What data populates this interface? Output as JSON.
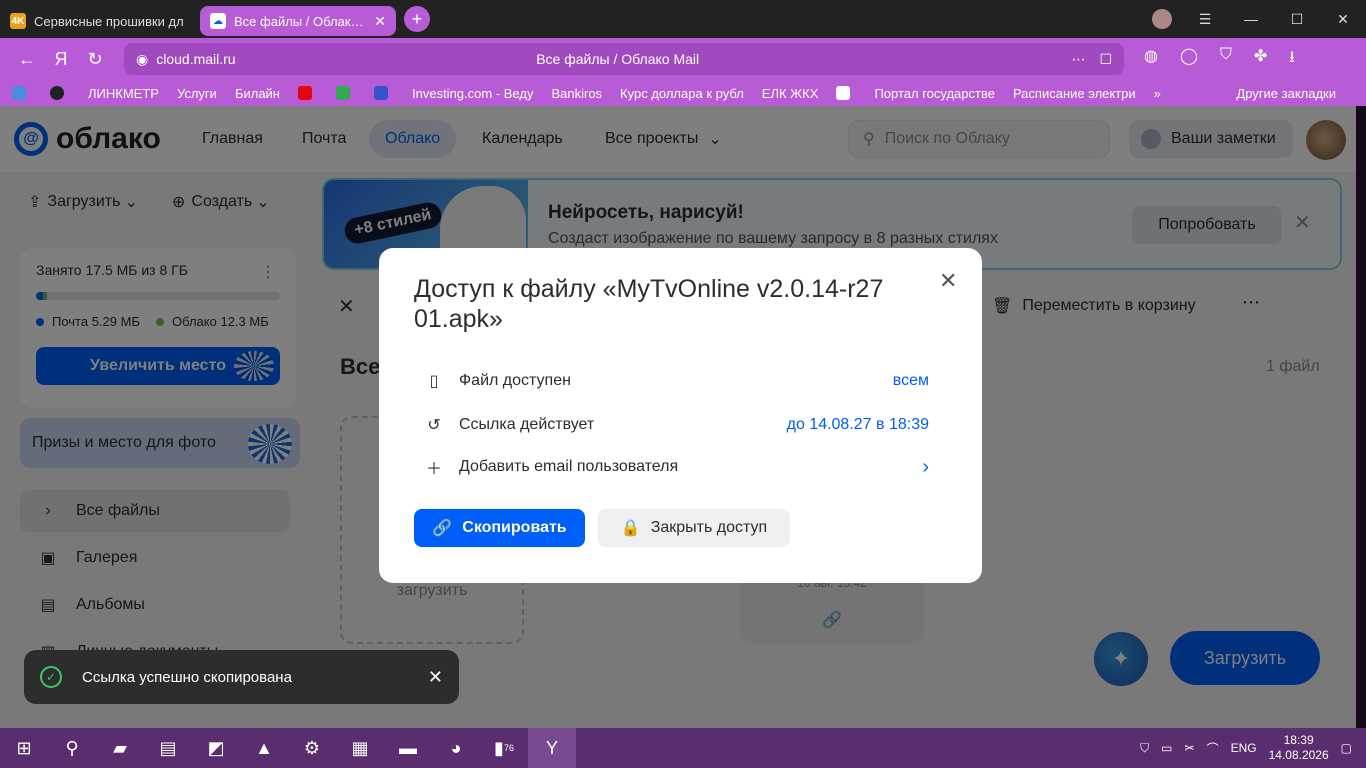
{
  "browser": {
    "tabs": [
      {
        "label": "Сервисные прошивки дл",
        "icon": "4k-icon"
      },
      {
        "label": "Все файлы / Облако Mail",
        "icon": "cloud-icon",
        "active": true
      }
    ],
    "url": "cloud.mail.ru",
    "page_title": "Все файлы / Облако Mail",
    "bookmarks": [
      "ЛИНКМЕТР",
      "Услуги",
      "Билайн",
      "Investing.com - Веду",
      "Bankiros",
      "Курс доллара к рубл",
      "ЕЛК ЖКХ",
      "Портал государстве",
      "Расписание электри"
    ],
    "bookmarks_more": "»",
    "bookmarks_other": "Другие закладки"
  },
  "header": {
    "logo": "облако",
    "nav": [
      "Главная",
      "Почта",
      "Облако",
      "Календарь",
      "Все проекты"
    ],
    "search_placeholder": "Поиск по Облаку",
    "notes": "Ваши заметки"
  },
  "sidebar": {
    "upload": "Загрузить",
    "create": "Создать",
    "storage_used": "Занято 17.5 МБ из 8 ГБ",
    "storage_fraction": 0.0022,
    "mail_label": "Почта 5.29 МБ",
    "cloud_label": "Облако 12.3 МБ",
    "increase": "Увеличить место",
    "prizes": "Призы и место для фото",
    "items": [
      "Все файлы",
      "Галерея",
      "Альбомы",
      "Личные документы"
    ]
  },
  "banner": {
    "badge_1": "+8",
    "badge_2": "стилей",
    "title": "Нейросеть, нарисуй!",
    "subtitle": "Создаст изображение по вашему запросу в 8 разных стилях",
    "button": "Попробовать"
  },
  "content": {
    "trash": "Переместить в корзину",
    "folder_title": "Все",
    "file_count": "1 файл",
    "upload_tile": "загрузить",
    "file_date": "10 авг. 15:42",
    "fab_upload": "Загрузить"
  },
  "modal": {
    "title": "Доступ к файлу «MyTvOnline v2.0.14-r2701.apk»",
    "title_line1": "Доступ к файлу «MyTvOnline v2.0.14-r27",
    "title_line2": "01.apk»",
    "row_access_label": "Файл доступен",
    "row_access_value": "всем",
    "row_expire_label": "Ссылка действует",
    "row_expire_value": "до 14.08.27 в 18:39",
    "row_email_label": "Добавить email пользователя",
    "copy_button": "Скопировать",
    "close_access_button": "Закрыть доступ"
  },
  "toast": {
    "message": "Ссылка успешно скопирована"
  },
  "taskbar": {
    "battery_badge": "76",
    "lang": "ENG",
    "time": "18:39",
    "date": "14.08.2026"
  },
  "colors": {
    "accent": "#005ff9",
    "browser": "#b85bd6",
    "taskbar": "#5a2e6e"
  }
}
